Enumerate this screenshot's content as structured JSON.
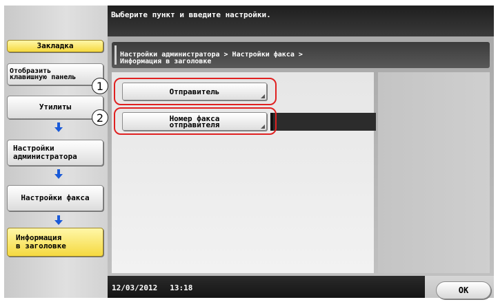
{
  "message": "Выберите пункт и введите настройки.",
  "sidebar": {
    "bookmark": "Закладка",
    "keypad_line1": "Отобразить",
    "keypad_line2": "клавишную панель",
    "utilities": "Утилиты",
    "admin_line1": "Настройки",
    "admin_line2": "администратора",
    "fax": "Настройки факса",
    "header_line1": "Информация",
    "header_line2": "в заголовке"
  },
  "breadcrumb": {
    "line1": "Настройки администратора  > Настройки факса  >",
    "line2": "Информация в заголовке"
  },
  "items": {
    "sender": "Отправитель",
    "fax_line1": "Номер факса",
    "fax_line2": "отправителя"
  },
  "callouts": [
    "1",
    "2"
  ],
  "status": {
    "date": "12/03/2012",
    "time": "13:18"
  },
  "ok_label": "OK",
  "colors": {
    "highlight": "#e02020",
    "active_button": "#f5d940",
    "arrow": "#1a5ad8"
  },
  "icons": {
    "step_arrow": "arrow-down-icon"
  }
}
